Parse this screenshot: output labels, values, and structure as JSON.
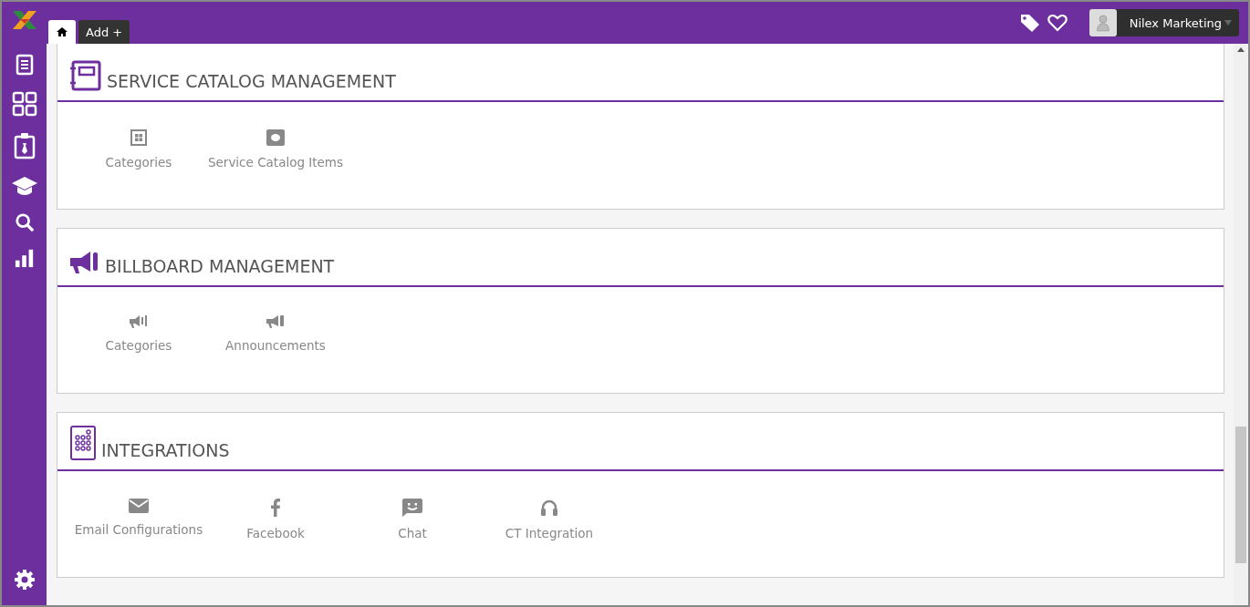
{
  "tabs": [
    {
      "kind": "home",
      "selected": true
    },
    {
      "kind": "add",
      "label": "Add +",
      "selected": false
    }
  ],
  "user": {
    "name": "Nilex Marketing"
  },
  "sections": [
    {
      "title": "SERVICE CATALOG MANAGEMENT",
      "kind": "catalog",
      "items": [
        {
          "label": "Categories",
          "kind": "grid"
        },
        {
          "label": "Service Catalog Items",
          "kind": "bubble"
        }
      ]
    },
    {
      "title": "BILLBOARD MANAGEMENT",
      "kind": "megaphone",
      "items": [
        {
          "label": "Categories",
          "kind": "megaphone-bars"
        },
        {
          "label": "Announcements",
          "kind": "megaphone"
        }
      ]
    },
    {
      "title": "INTEGRATIONS",
      "kind": "keypad",
      "items": [
        {
          "label": "Email Configurations",
          "kind": "mail"
        },
        {
          "label": "Facebook",
          "kind": "facebook"
        },
        {
          "label": "Chat",
          "kind": "chat"
        },
        {
          "label": "CT Integration",
          "kind": "headset"
        }
      ]
    }
  ]
}
